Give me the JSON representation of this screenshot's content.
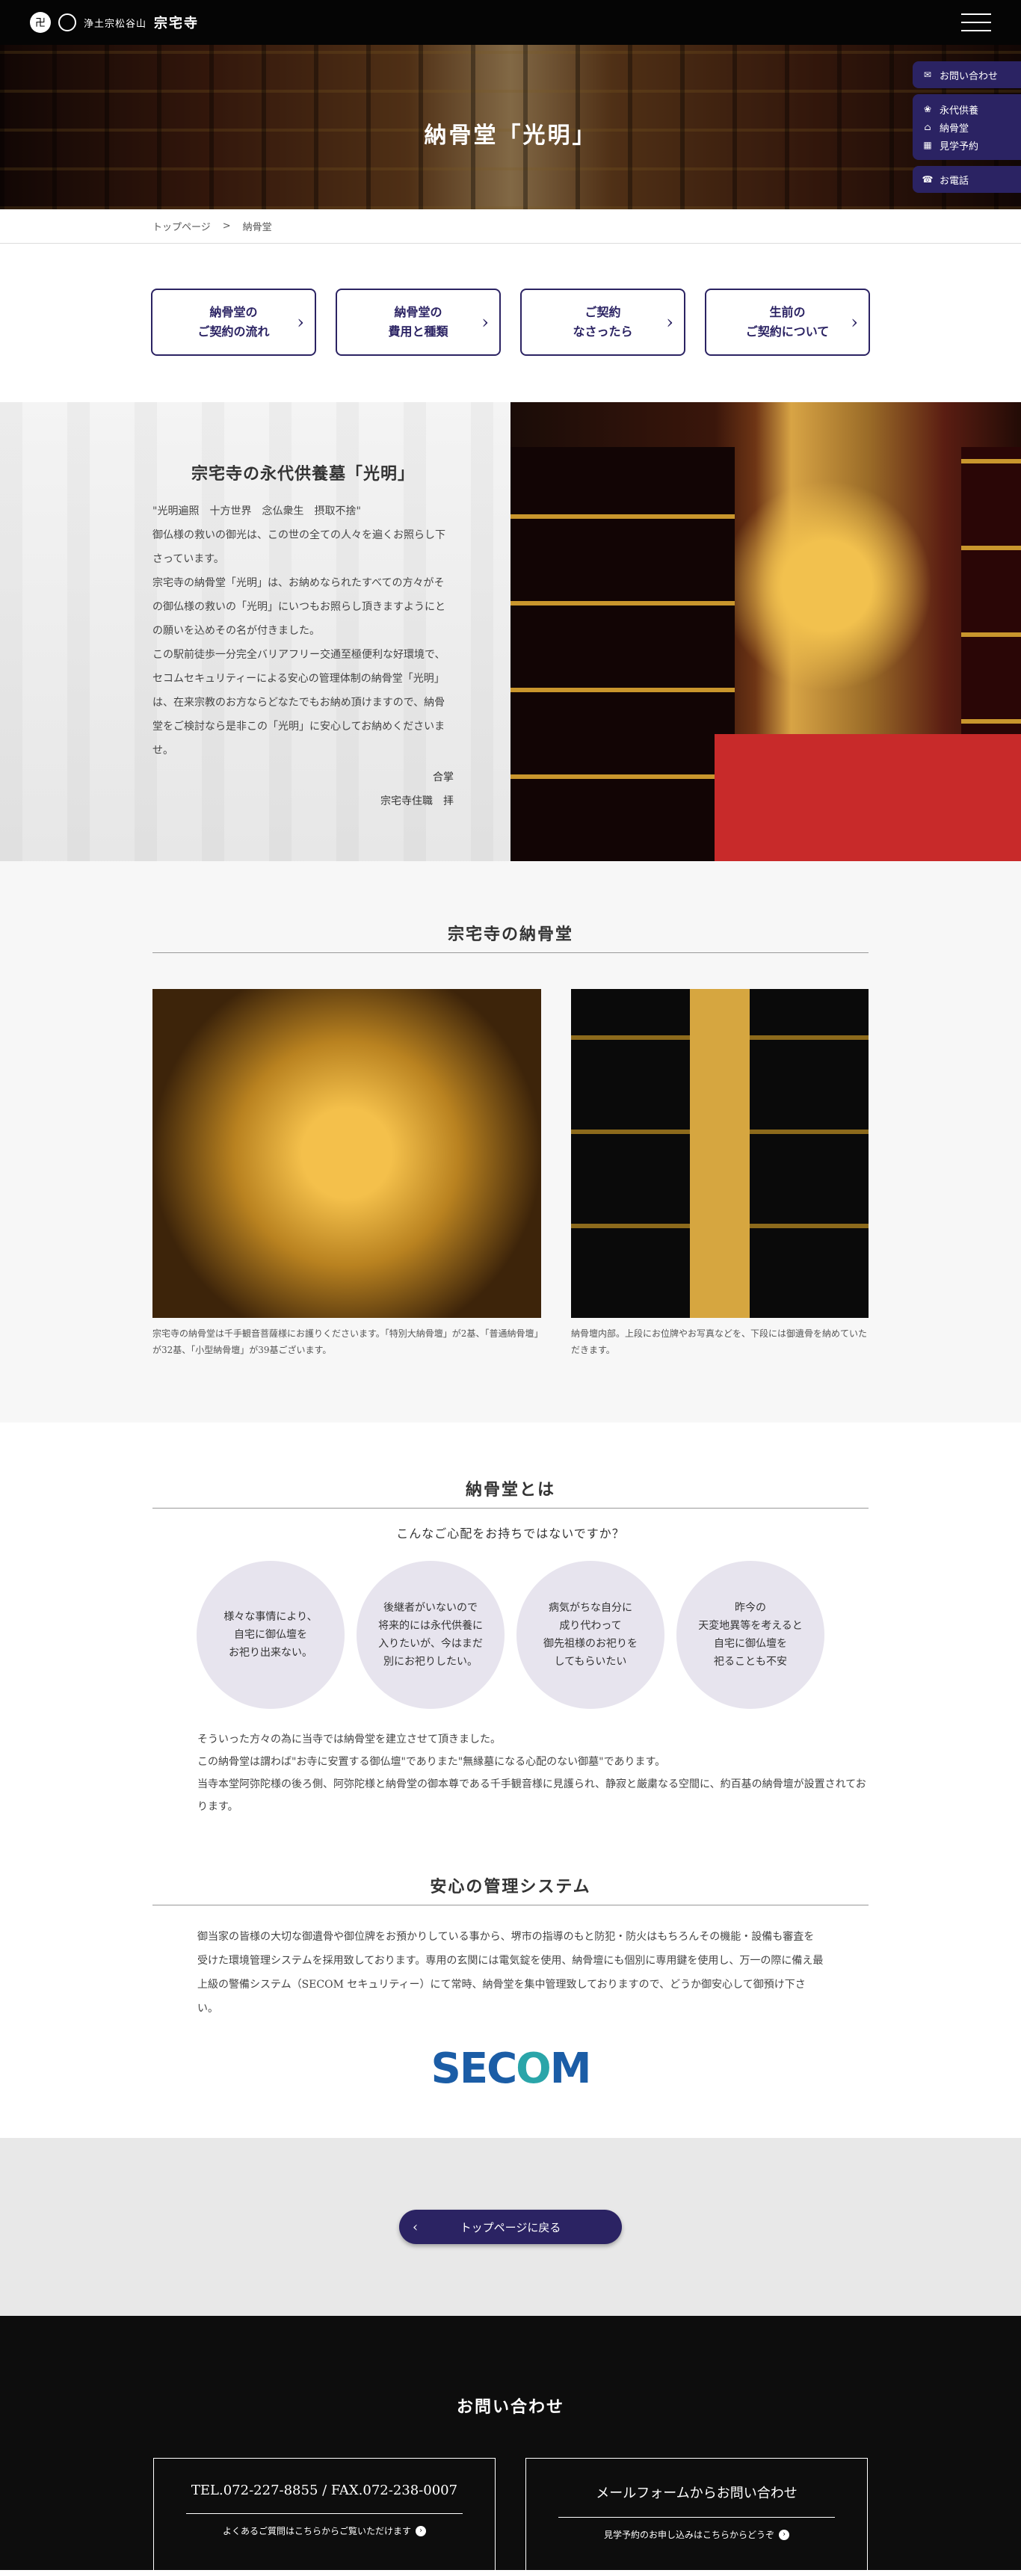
{
  "header": {
    "logo_sub": "浄土宗松谷山",
    "logo_main": "宗宅寺"
  },
  "hero": {
    "title": "納骨堂「光明」"
  },
  "side_nav": {
    "inquiry": "お問い合わせ",
    "items": [
      "永代供養",
      "納骨堂",
      "見学予約"
    ],
    "phone": "お電話"
  },
  "breadcrumb": {
    "home": "トップページ",
    "sep": ">",
    "current": "納骨堂"
  },
  "nav_cards": [
    {
      "line1": "納骨堂の",
      "line2": "ご契約の流れ"
    },
    {
      "line1": "納骨堂の",
      "line2": "費用と種類"
    },
    {
      "line1": "ご契約",
      "line2": "なさったら"
    },
    {
      "line1": "生前の",
      "line2": "ご契約について"
    }
  ],
  "intro": {
    "title": "宗宅寺の永代供養墓「光明」",
    "paragraphs": [
      "\"光明遍照　十方世界　念仏衆生　摂取不捨\"",
      "御仏様の救いの御光は、この世の全ての人々を遍くお照らし下さっています。",
      "宗宅寺の納骨堂「光明」は、お納めなられたすべての方々がその御仏様の救いの「光明」にいつもお照らし頂きますようにとの願いを込めその名が付きました。",
      "この駅前徒歩一分完全バリアフリー交通至極便利な好環境で、セコムセキュリティーによる安心の管理体制の納骨堂「光明」は、在来宗教のお方ならどなたでもお納め頂けますので、納骨堂をご検討なら是非この「光明」に安心してお納めくださいませ。"
    ],
    "sign1": "合掌",
    "sign2": "宗宅寺住職　拝"
  },
  "nokotsu": {
    "title": "宗宅寺の納骨堂",
    "caption_a": "宗宅寺の納骨堂は千手観音菩薩様にお護りくださいます。「特別大納骨壇」が2基、「普通納骨壇」が32基、「小型納骨壇」が39基ございます。",
    "caption_b": "納骨壇内部。上段にお位牌やお写真などを、下段には御遺骨を納めていただきます。"
  },
  "about": {
    "title": "納骨堂とは",
    "subtitle": "こんなご心配をお持ちではないですか？",
    "circles": [
      [
        "様々な事情により、",
        "自宅に御仏壇を",
        "お祀り出来ない。"
      ],
      [
        "後継者がいないので",
        "将来的には永代供養に",
        "入りたいが、今はまだ",
        "別にお祀りしたい。"
      ],
      [
        "病気がちな自分に",
        "成り代わって",
        "御先祖様のお祀りを",
        "してもらいたい"
      ],
      [
        "昨今の",
        "天変地異等を考えると",
        "自宅に御仏壇を",
        "祀ることも不安"
      ]
    ],
    "paragraphs": [
      "そういった方々の為に当寺では納骨堂を建立させて頂きました。",
      "この納骨堂は謂わば\"お寺に安置する御仏壇\"でありまた\"無縁墓になる心配のない御墓\"であります。",
      "当寺本堂阿弥陀様の後ろ側、阿弥陀様と納骨堂の御本尊である千手観音様に見護られ、静寂と厳粛なる空間に、約百基の納骨壇が設置されております。"
    ]
  },
  "security": {
    "title": "安心の管理システム",
    "text": "御当家の皆様の大切な御遺骨や御位牌をお預かりしている事から、堺市の指導のもと防犯・防火はもちろんその機能・設備も審査を受けた環境管理システムを採用致しております。専用の玄関には電気錠を使用、納骨壇にも個別に専用鍵を使用し、万一の際に備え最上級の警備システム（SECOM セキュリティー）にて常時、納骨堂を集中管理致しておりますので、どうか御安心して御預け下さい。",
    "logo_a": "SEC",
    "logo_b": "O",
    "logo_c": "M"
  },
  "back_button": "トップページに戻る",
  "footer": {
    "title": "お問い合わせ",
    "tel": "TEL.072-227-8855 / FAX.072-238-0007",
    "tel_sub": "よくあるご質問はこちらからご覧いただけます",
    "form": "メールフォームからお問い合わせ",
    "form_sub": "見学予約のお申し込みはこちらからどうぞ"
  }
}
